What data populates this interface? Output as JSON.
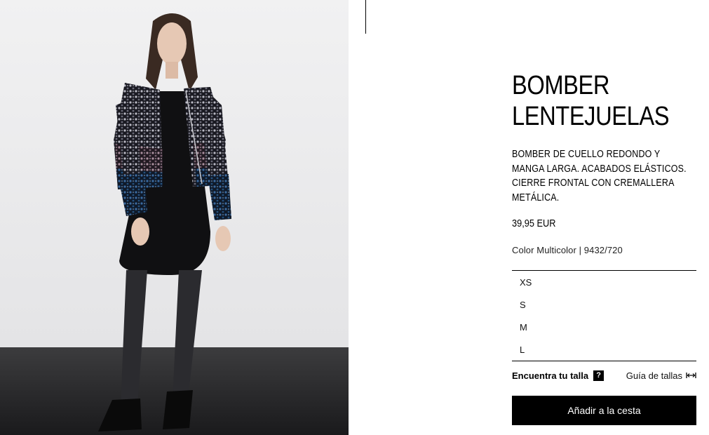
{
  "product": {
    "title": "BOMBER\nLENTEJUELAS",
    "description": "BOMBER DE CUELLO REDONDO Y MANGA LARGA. ACABADOS ELÁSTICOS. CIERRE FRONTAL CON CREMALLERA METÁLICA.",
    "price": "39,95 EUR",
    "color_line": "Color Multicolor | 9432/720"
  },
  "sizes": [
    "XS",
    "S",
    "M",
    "L"
  ],
  "size_help": {
    "find_label": "Encuentra tu talla",
    "find_icon": "question-icon",
    "guide_label": "Guía de tallas",
    "guide_icon": "ruler-icon"
  },
  "cart": {
    "add_label": "Añadir a la cesta"
  },
  "colors": {
    "accent": "#000000",
    "background": "#ffffff"
  }
}
